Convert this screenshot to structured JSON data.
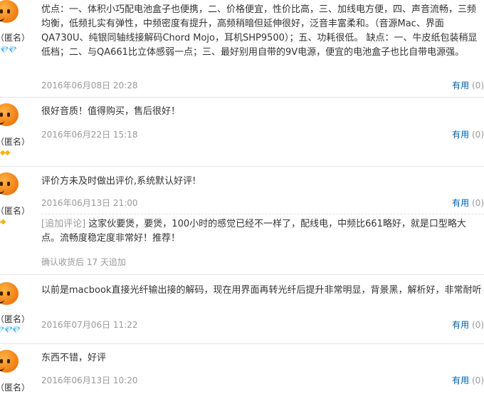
{
  "reviews": [
    {
      "user": "（匿名）",
      "badge": "💎💎",
      "content": "优点：一、体积小巧配电池盒子也便携，二、价格便宜，性价比高，三、加线电方便，四、声音流畅，三频均衡，低频扎实有弹性，中频密度有提升，高频稍暗但延伸很好，泛音丰富柔和。（音源Mac、界面QA730U、纯银同轴线接解码Chord Mojo，耳机SHP9500）；五、功耗很低。 缺点：一、牛皮纸包装稍显低档；二、与QA661比立体感弱一点；三、最好别用自带的9V电源，便宜的电池盒子也比自带电源强。",
      "date": "2016年06月08日 20:28",
      "useful_label": "有用",
      "useful_count": "(0)"
    },
    {
      "user": "（匿名）",
      "badge": "◆◆",
      "content": "很好音质！值得购买，售后很好！",
      "date": "2016年06月22日 15:18",
      "useful_label": "有用",
      "useful_count": "(0)"
    },
    {
      "user": "（匿名）",
      "badge": "◆◆",
      "content": "评价方未及时做出评价,系统默认好评!",
      "date": "2016年06月13日 21:00",
      "useful_label": "有用",
      "useful_count": "(0)",
      "append_tag": "[追加评论]",
      "append_text": "这家伙要煲，要煲，100小时的感觉已经不一样了，配线电，中频比661略好，就是口型略大点。流畅度稳定度非常好！推荐！",
      "append_time": "确认收货后 17 天追加"
    },
    {
      "user": "（匿名）",
      "badge": "💎💎💎",
      "content": "以前是macbook直接光纤输出接的解码，现在用界面再转光纤后提升非常明显，背景黑，解析好，非常耐听",
      "date": "2016年07月06日 11:22",
      "useful_label": "有用",
      "useful_count": "(0)"
    },
    {
      "user": "（匿名）",
      "badge": "",
      "content": "东西不错，好评",
      "date": "2016年06月13日 10:20",
      "useful_label": "有用",
      "useful_count": "(0)"
    }
  ]
}
